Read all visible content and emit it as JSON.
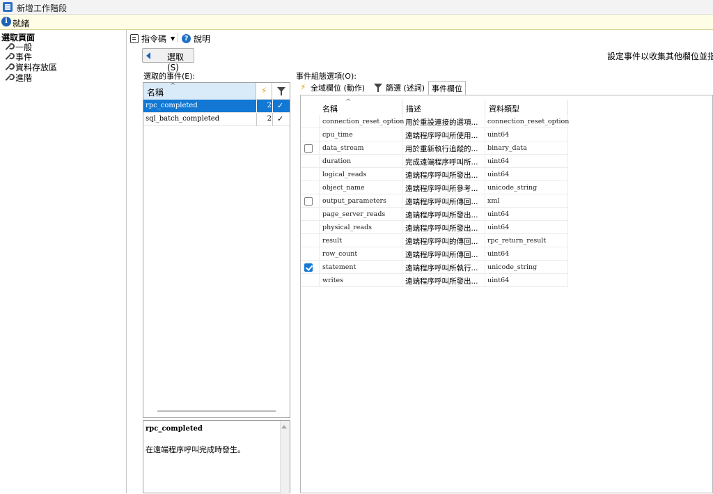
{
  "window": {
    "title": "新增工作階段"
  },
  "status": {
    "text": "就緒"
  },
  "left_pane": {
    "header": "選取頁面",
    "items": [
      {
        "label": "一般"
      },
      {
        "label": "事件"
      },
      {
        "label": "資料存放區"
      },
      {
        "label": "進階"
      }
    ]
  },
  "toolbar": {
    "script_label": "指令碼",
    "help_label": "說明"
  },
  "select_button": {
    "label": "選取(S)"
  },
  "hint": "設定事件以收集其他欄位並指定",
  "events": {
    "label": "選取的事件(E):",
    "header_name": "名稱",
    "rows": [
      {
        "name": "rpc_completed",
        "count": "2",
        "selected": true
      },
      {
        "name": "sql_batch_completed",
        "count": "2",
        "selected": false
      }
    ]
  },
  "description": {
    "title": "rpc_completed",
    "body": "在遠端程序呼叫完成時發生。"
  },
  "options": {
    "label": "事件組態選項(O):",
    "tabs": [
      {
        "label": "全域欄位 (動作)"
      },
      {
        "label": "篩選 (述詞)"
      },
      {
        "label": "事件欄位"
      }
    ],
    "grid_headers": {
      "name": "名稱",
      "desc": "描述",
      "type": "資料類型"
    },
    "fields": [
      {
        "name": "connection_reset_option",
        "desc": "用於重設連接的選項...",
        "type": "connection_reset_option",
        "checkbox": false,
        "checked": false
      },
      {
        "name": "cpu_time",
        "desc": "遠端程序呼叫所使用...",
        "type": "uint64",
        "checkbox": false,
        "checked": false
      },
      {
        "name": "data_stream",
        "desc": "用於重新執行追蹤的...",
        "type": "binary_data",
        "checkbox": true,
        "checked": false
      },
      {
        "name": "duration",
        "desc": "完成遠端程序呼叫所...",
        "type": "uint64",
        "checkbox": false,
        "checked": false
      },
      {
        "name": "logical_reads",
        "desc": "遠端程序呼叫所發出...",
        "type": "uint64",
        "checkbox": false,
        "checked": false
      },
      {
        "name": "object_name",
        "desc": "遠端程序呼叫所參考...",
        "type": "unicode_string",
        "checkbox": false,
        "checked": false
      },
      {
        "name": "output_parameters",
        "desc": "遠端程序呼叫所傳回...",
        "type": "xml",
        "checkbox": true,
        "checked": false
      },
      {
        "name": "page_server_reads",
        "desc": "遠端程序呼叫所發出...",
        "type": "uint64",
        "checkbox": false,
        "checked": false
      },
      {
        "name": "physical_reads",
        "desc": "遠端程序呼叫所發出...",
        "type": "uint64",
        "checkbox": false,
        "checked": false
      },
      {
        "name": "result",
        "desc": "遠端程序呼叫的傳回...",
        "type": "rpc_return_result",
        "checkbox": false,
        "checked": false
      },
      {
        "name": "row_count",
        "desc": "遠端程序呼叫所傳回...",
        "type": "uint64",
        "checkbox": false,
        "checked": false
      },
      {
        "name": "statement",
        "desc": "遠端程序呼叫所執行...",
        "type": "unicode_string",
        "checkbox": true,
        "checked": true
      },
      {
        "name": "writes",
        "desc": "遠端程序呼叫所發出...",
        "type": "uint64",
        "checkbox": false,
        "checked": false
      }
    ]
  },
  "colors": {
    "selection": "#1278d4",
    "status_bg": "#fffde6",
    "header_highlight": "#d9eaf8"
  }
}
